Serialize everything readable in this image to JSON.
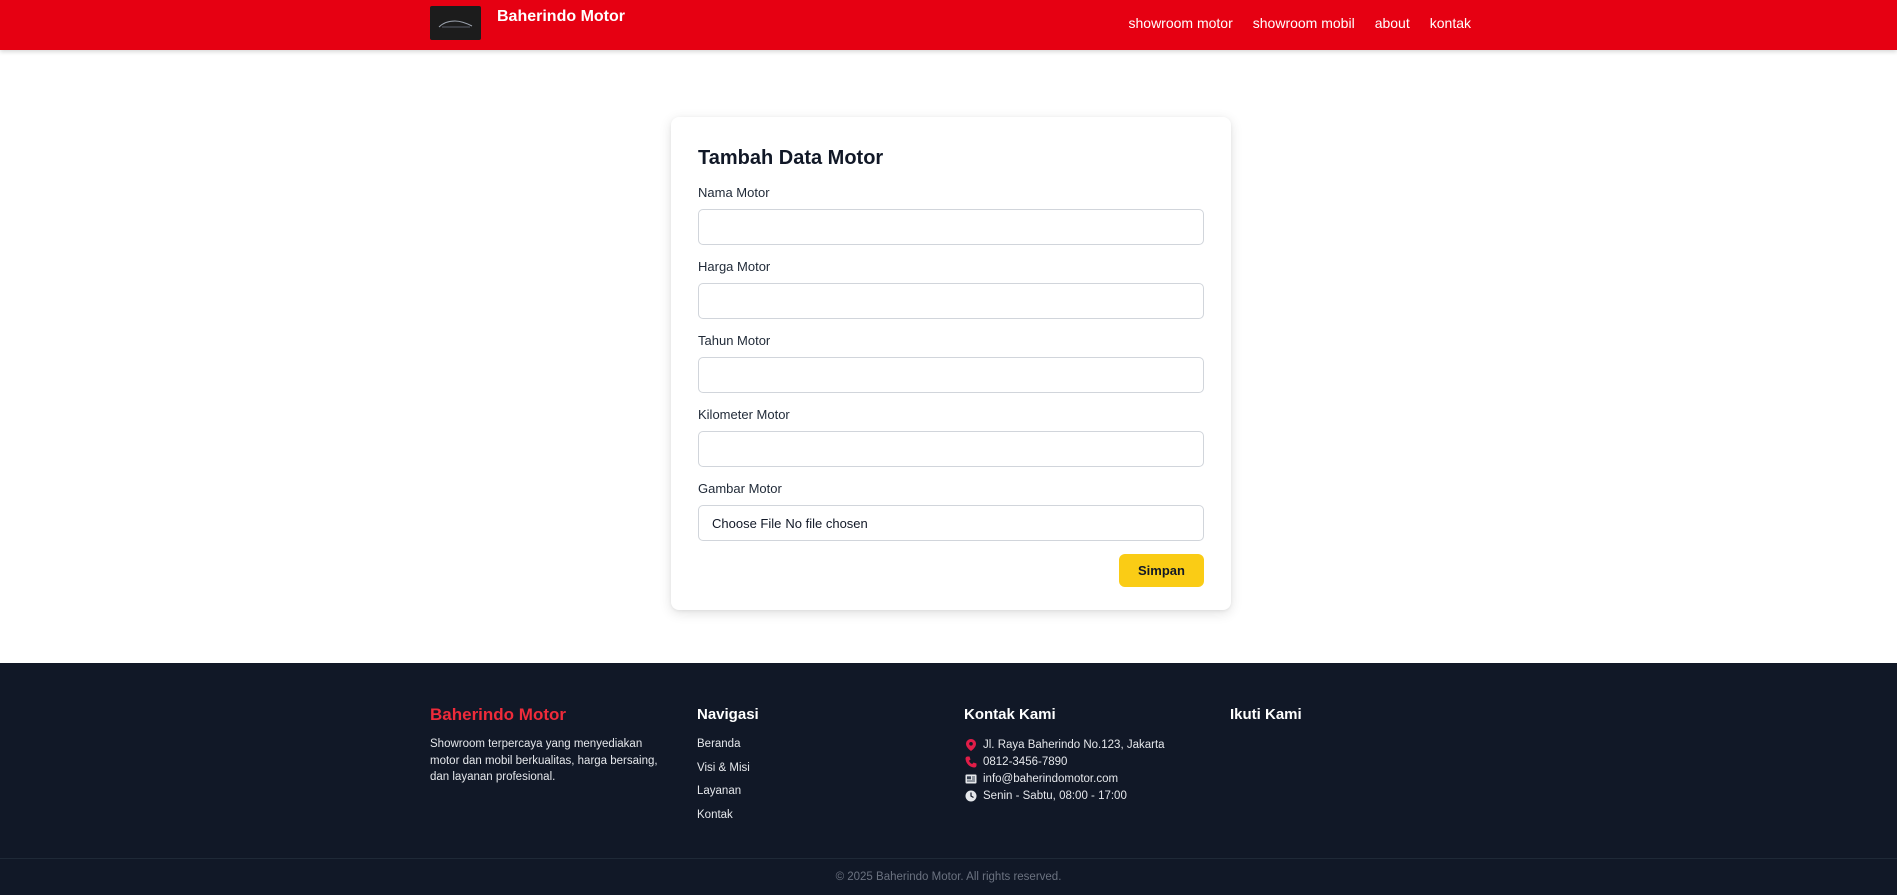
{
  "header": {
    "brand_name": "Baherindo Motor",
    "nav": [
      "showroom motor",
      "showroom mobil",
      "about",
      "kontak"
    ]
  },
  "form": {
    "title": "Tambah Data Motor",
    "fields": [
      {
        "label": "Nama Motor",
        "value": ""
      },
      {
        "label": "Harga Motor",
        "value": ""
      },
      {
        "label": "Tahun Motor",
        "value": ""
      },
      {
        "label": "Kilometer Motor",
        "value": ""
      }
    ],
    "file_field": {
      "label": "Gambar Motor",
      "button_label": "Choose File",
      "status_text": "No file chosen"
    },
    "submit_label": "Simpan"
  },
  "footer": {
    "brand": {
      "title": "Baherindo Motor",
      "description": "Showroom terpercaya yang menyediakan motor dan mobil berkualitas, harga bersaing, dan layanan profesional."
    },
    "navigation": {
      "title": "Navigasi",
      "items": [
        "Beranda",
        "Visi & Misi",
        "Layanan",
        "Kontak"
      ]
    },
    "contact": {
      "title": "Kontak Kami",
      "items": [
        {
          "icon": "map-pin-icon",
          "text": "Jl. Raya Baherindo No.123, Jakarta"
        },
        {
          "icon": "phone-icon",
          "text": "0812-3456-7890"
        },
        {
          "icon": "email-icon",
          "text": "info@baherindomotor.com"
        },
        {
          "icon": "clock-icon",
          "text": "Senin - Sabtu, 08:00 - 17:00"
        }
      ]
    },
    "follow": {
      "title": "Ikuti Kami"
    },
    "copyright": "© 2025 Baherindo Motor. All rights reserved."
  },
  "colors": {
    "header_red": "#e60012",
    "footer_bg": "#111827",
    "brand_red": "#ef2b3a",
    "button_yellow": "#facc15"
  }
}
